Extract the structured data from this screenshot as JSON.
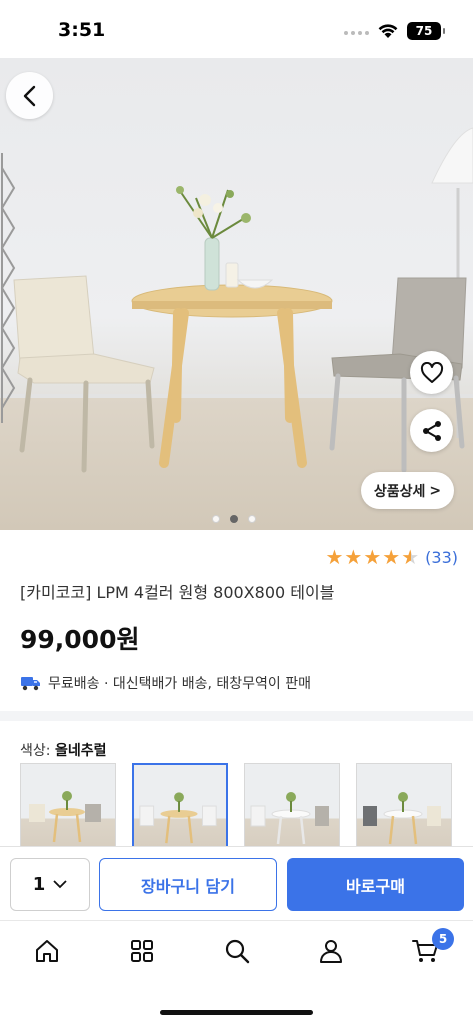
{
  "status_bar": {
    "time": "3:51",
    "battery": "75"
  },
  "hero": {
    "detail_button_label": "상품상세",
    "detail_chevron": ">",
    "page_count": 3,
    "active_page": 2
  },
  "product": {
    "rating": 4.5,
    "review_count": "(33)",
    "title": "[카미코코] LPM 4컬러 원형 800X800 테이블",
    "price": "99,000원",
    "shipping_text": "무료배송 · 대신택배가 배송, 태창무역이 판매"
  },
  "options": {
    "label": "색상: ",
    "selected_value": "올네추럴",
    "thumbnails": [
      {
        "selected": false
      },
      {
        "selected": true
      },
      {
        "selected": false
      },
      {
        "selected": false
      }
    ]
  },
  "purchase_bar": {
    "quantity": "1",
    "cart_label": "장바구니 담기",
    "buy_label": "바로구매"
  },
  "tab_bar": {
    "tabs": [
      "home-icon",
      "category-grid-icon",
      "search-icon",
      "profile-icon",
      "cart-icon"
    ],
    "cart_badge": "5"
  },
  "colors": {
    "accent": "#3b73e8",
    "star": "#f5a13a"
  }
}
